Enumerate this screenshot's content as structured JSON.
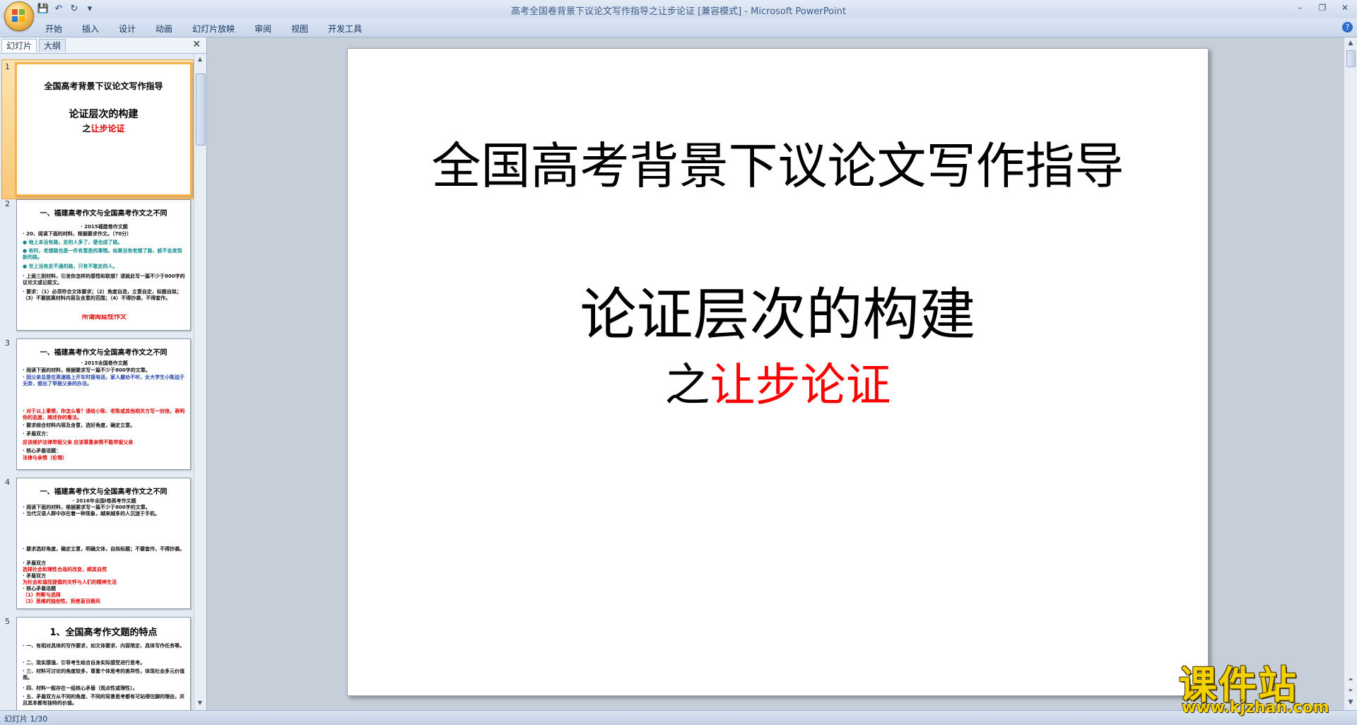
{
  "window": {
    "title": "高考全国卷背景下议论文写作指导之让步论证 [兼容模式] - Microsoft PowerPoint"
  },
  "quick_access": [
    {
      "name": "save-icon",
      "glyph": "💾"
    },
    {
      "name": "undo-icon",
      "glyph": "↶"
    },
    {
      "name": "redo-icon",
      "glyph": "↻"
    },
    {
      "name": "customize-icon",
      "glyph": "▾"
    }
  ],
  "ribbon": {
    "tabs": [
      "开始",
      "插入",
      "设计",
      "动画",
      "幻灯片放映",
      "审阅",
      "视图",
      "开发工具"
    ],
    "help": "?"
  },
  "pane": {
    "tab_slides": "幻灯片",
    "tab_outline": "大纲",
    "close": "✕"
  },
  "thumbnails": [
    {
      "num": "1",
      "title": "全国高考背景下议论文写作指导",
      "sub": "论证层次的构建",
      "sub2_prefix": "之",
      "sub2_red": "让步论证"
    },
    {
      "num": "2",
      "title": "一、福建高考作文与全国高考作文之不同",
      "lines": [
        "· 2015福建卷作文题",
        "· 20、阅读下面的材料，根据要求作文。（70分）",
        "● 地上本没有路，走的人多了，便也成了路。",
        "● 有时，老想路也是一件有意思的事情。如果没有老想了路，就不会发现新的路。",
        "● 世上没有走不通的路，只有不敢走的人。",
        "· 上面三则材料，引发你怎样的感悟和联想？请就此写一篇不少于800字的议论文或记叙文。",
        "· 要求：（1）必须符合文体要求；（2）角度自选，立意自定，标题自拟；（3）不要脱离材料内容及含意的范围；（4）不得抄袭，不得套作。",
        "所谓阅延性作文"
      ]
    },
    {
      "num": "3",
      "title": "一、福建高考作文与全国高考作文之不同",
      "lines": [
        "· 2015全国卷作文题",
        "· 阅读下面的材料，根据要求写一篇不少于800字的文章。",
        "· 因父亲总是在高速路上开车时接电话，家人屡劝不听，女大学生小陈迫于无奈，想出了举报父亲的办法。",
        "· 对于以上事情，你怎么看？请给小陈、老陈或其他相关方写一封信，表明你的态度，阐述你的看法。",
        "· 要求综合材料内容及含意，选好角度，确定立意。",
        "· 矛盾双方：",
        "    应该维护法律举报父亲   应该尊重亲情不能举报父亲",
        "· 核心矛盾话题：",
        "    法律与亲情（伦理）"
      ]
    },
    {
      "num": "4",
      "title": "一、福建高考作文与全国高考作文之不同",
      "lines": [
        "· 2016年全国I卷高考作文题",
        "· 阅读下面的材料，根据要求写一篇不少于800字的文章。",
        "· 当代汉语人群中存在着一种现象，越来越多的人沉迷于手机。",
        "· 要求选好角度，确定立意，明确文体，自拟标题；不要套作，不得抄袭。",
        "· 矛盾双方",
        "    选择社会和理性合适的改变，顺其自然",
        "· 矛盾双方",
        "    为社会和谐而提倡的关怀与人们的精神生活",
        "· 核心矛盾话题",
        "    （1）判断与选择",
        "    （2）思维的独创性，拒绝盲目跟风"
      ]
    },
    {
      "num": "5",
      "title": "1、全国高考作文题的特点",
      "lines": [
        "· 一、有相对具体的写作要求，如文体要求、内容限定、具体写作任务等。",
        "· 二、现实感强，引导考生结合自身实际感受进行思考。",
        "· 三、材料可讨论的角度较多，尊重个体思考的差异性，体现社会多元价值观。",
        "· 四、材料一般存在一组核心矛盾（观点性或理性）。",
        "· 五、矛盾双方从不同的角度、不同的背景思考都有可站得住脚的理由，并且其本都有独特的价值。"
      ]
    }
  ],
  "slide": {
    "title": "全国高考背景下议论文写作指导",
    "subtitle": "论证层次的构建",
    "sub2_prefix": "之",
    "sub2_red": "让步论证",
    "red_color": "#ff0000"
  },
  "status": {
    "slide_count": "幻灯片 1/30"
  },
  "watermark": {
    "text": "课件站",
    "url": "www.kjzhan.com"
  }
}
